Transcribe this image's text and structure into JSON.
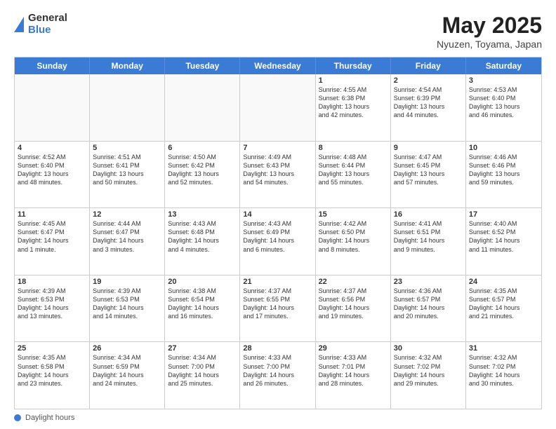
{
  "header": {
    "logo_line1": "General",
    "logo_line2": "Blue",
    "title": "May 2025",
    "subtitle": "Nyuzen, Toyama, Japan"
  },
  "days": [
    "Sunday",
    "Monday",
    "Tuesday",
    "Wednesday",
    "Thursday",
    "Friday",
    "Saturday"
  ],
  "footer_label": "Daylight hours",
  "rows": [
    [
      {
        "num": "",
        "text": "",
        "empty": true
      },
      {
        "num": "",
        "text": "",
        "empty": true
      },
      {
        "num": "",
        "text": "",
        "empty": true
      },
      {
        "num": "",
        "text": "",
        "empty": true
      },
      {
        "num": "1",
        "text": "Sunrise: 4:55 AM\nSunset: 6:38 PM\nDaylight: 13 hours\nand 42 minutes."
      },
      {
        "num": "2",
        "text": "Sunrise: 4:54 AM\nSunset: 6:39 PM\nDaylight: 13 hours\nand 44 minutes."
      },
      {
        "num": "3",
        "text": "Sunrise: 4:53 AM\nSunset: 6:40 PM\nDaylight: 13 hours\nand 46 minutes."
      }
    ],
    [
      {
        "num": "4",
        "text": "Sunrise: 4:52 AM\nSunset: 6:40 PM\nDaylight: 13 hours\nand 48 minutes."
      },
      {
        "num": "5",
        "text": "Sunrise: 4:51 AM\nSunset: 6:41 PM\nDaylight: 13 hours\nand 50 minutes."
      },
      {
        "num": "6",
        "text": "Sunrise: 4:50 AM\nSunset: 6:42 PM\nDaylight: 13 hours\nand 52 minutes."
      },
      {
        "num": "7",
        "text": "Sunrise: 4:49 AM\nSunset: 6:43 PM\nDaylight: 13 hours\nand 54 minutes."
      },
      {
        "num": "8",
        "text": "Sunrise: 4:48 AM\nSunset: 6:44 PM\nDaylight: 13 hours\nand 55 minutes."
      },
      {
        "num": "9",
        "text": "Sunrise: 4:47 AM\nSunset: 6:45 PM\nDaylight: 13 hours\nand 57 minutes."
      },
      {
        "num": "10",
        "text": "Sunrise: 4:46 AM\nSunset: 6:46 PM\nDaylight: 13 hours\nand 59 minutes."
      }
    ],
    [
      {
        "num": "11",
        "text": "Sunrise: 4:45 AM\nSunset: 6:47 PM\nDaylight: 14 hours\nand 1 minute."
      },
      {
        "num": "12",
        "text": "Sunrise: 4:44 AM\nSunset: 6:47 PM\nDaylight: 14 hours\nand 3 minutes."
      },
      {
        "num": "13",
        "text": "Sunrise: 4:43 AM\nSunset: 6:48 PM\nDaylight: 14 hours\nand 4 minutes."
      },
      {
        "num": "14",
        "text": "Sunrise: 4:43 AM\nSunset: 6:49 PM\nDaylight: 14 hours\nand 6 minutes."
      },
      {
        "num": "15",
        "text": "Sunrise: 4:42 AM\nSunset: 6:50 PM\nDaylight: 14 hours\nand 8 minutes."
      },
      {
        "num": "16",
        "text": "Sunrise: 4:41 AM\nSunset: 6:51 PM\nDaylight: 14 hours\nand 9 minutes."
      },
      {
        "num": "17",
        "text": "Sunrise: 4:40 AM\nSunset: 6:52 PM\nDaylight: 14 hours\nand 11 minutes."
      }
    ],
    [
      {
        "num": "18",
        "text": "Sunrise: 4:39 AM\nSunset: 6:53 PM\nDaylight: 14 hours\nand 13 minutes."
      },
      {
        "num": "19",
        "text": "Sunrise: 4:39 AM\nSunset: 6:53 PM\nDaylight: 14 hours\nand 14 minutes."
      },
      {
        "num": "20",
        "text": "Sunrise: 4:38 AM\nSunset: 6:54 PM\nDaylight: 14 hours\nand 16 minutes."
      },
      {
        "num": "21",
        "text": "Sunrise: 4:37 AM\nSunset: 6:55 PM\nDaylight: 14 hours\nand 17 minutes."
      },
      {
        "num": "22",
        "text": "Sunrise: 4:37 AM\nSunset: 6:56 PM\nDaylight: 14 hours\nand 19 minutes."
      },
      {
        "num": "23",
        "text": "Sunrise: 4:36 AM\nSunset: 6:57 PM\nDaylight: 14 hours\nand 20 minutes."
      },
      {
        "num": "24",
        "text": "Sunrise: 4:35 AM\nSunset: 6:57 PM\nDaylight: 14 hours\nand 21 minutes."
      }
    ],
    [
      {
        "num": "25",
        "text": "Sunrise: 4:35 AM\nSunset: 6:58 PM\nDaylight: 14 hours\nand 23 minutes."
      },
      {
        "num": "26",
        "text": "Sunrise: 4:34 AM\nSunset: 6:59 PM\nDaylight: 14 hours\nand 24 minutes."
      },
      {
        "num": "27",
        "text": "Sunrise: 4:34 AM\nSunset: 7:00 PM\nDaylight: 14 hours\nand 25 minutes."
      },
      {
        "num": "28",
        "text": "Sunrise: 4:33 AM\nSunset: 7:00 PM\nDaylight: 14 hours\nand 26 minutes."
      },
      {
        "num": "29",
        "text": "Sunrise: 4:33 AM\nSunset: 7:01 PM\nDaylight: 14 hours\nand 28 minutes."
      },
      {
        "num": "30",
        "text": "Sunrise: 4:32 AM\nSunset: 7:02 PM\nDaylight: 14 hours\nand 29 minutes."
      },
      {
        "num": "31",
        "text": "Sunrise: 4:32 AM\nSunset: 7:02 PM\nDaylight: 14 hours\nand 30 minutes."
      }
    ]
  ]
}
